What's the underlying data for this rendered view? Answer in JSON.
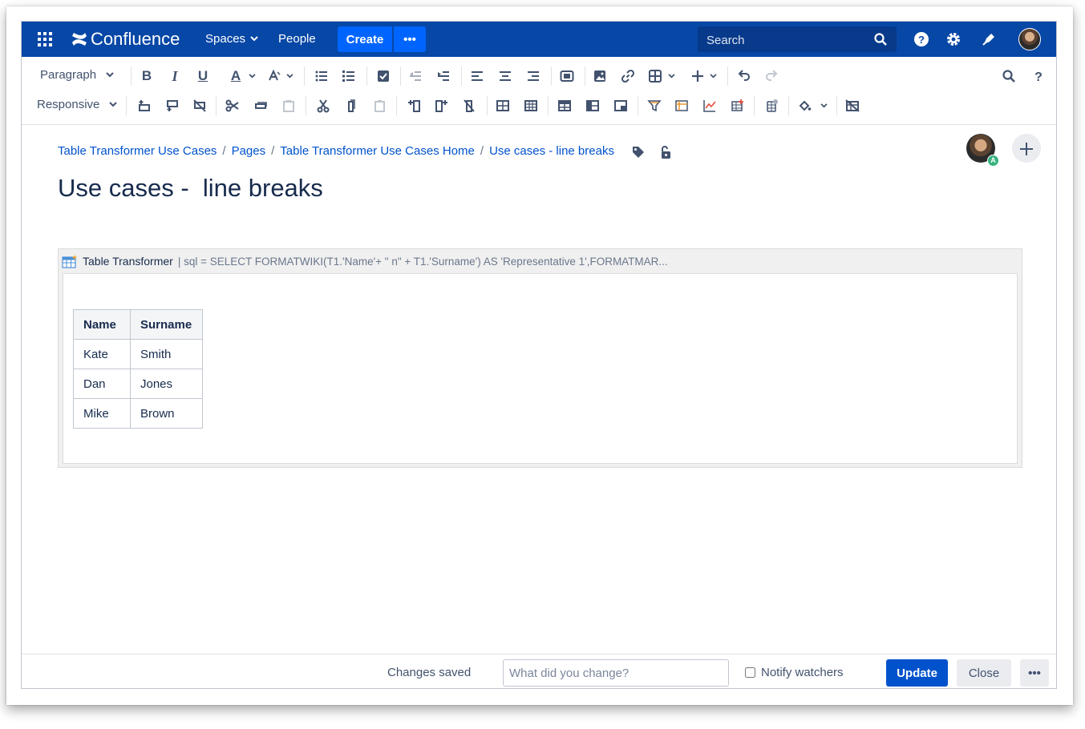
{
  "topnav": {
    "product": "Confluence",
    "spaces": "Spaces",
    "people": "People",
    "create": "Create",
    "more": "•••",
    "search_placeholder": "Search"
  },
  "toolbar": {
    "paragraph": "Paragraph",
    "responsive": "Responsive",
    "bold": "B",
    "italic": "I",
    "underline": "U",
    "text_color": "A"
  },
  "breadcrumb": [
    "Table Transformer Use Cases",
    "Pages",
    "Table Transformer Use Cases Home",
    "Use cases - line breaks"
  ],
  "breadcrumb_separator": "/",
  "page": {
    "title": "Use cases -  line breaks",
    "editor_badge": "A"
  },
  "macro": {
    "name": "Table Transformer",
    "params": "| sql = SELECT FORMATWIKI(T1.'Name'+ \" n\" + T1.'Surname') AS 'Representative 1',FORMATMAR...",
    "table": {
      "headers": [
        "Name",
        "Surname"
      ],
      "rows": [
        [
          "Kate",
          "Smith"
        ],
        [
          "Dan",
          "Jones"
        ],
        [
          "Mike",
          "Brown"
        ]
      ]
    }
  },
  "footer": {
    "status": "Changes saved",
    "comment_placeholder": "What did you change?",
    "notify": "Notify watchers",
    "update": "Update",
    "close": "Close",
    "more": "•••"
  },
  "colors": {
    "nav": "#0747a6",
    "primary": "#0052cc",
    "create": "#0065ff",
    "text": "#172b4d",
    "muted": "#42526e"
  }
}
